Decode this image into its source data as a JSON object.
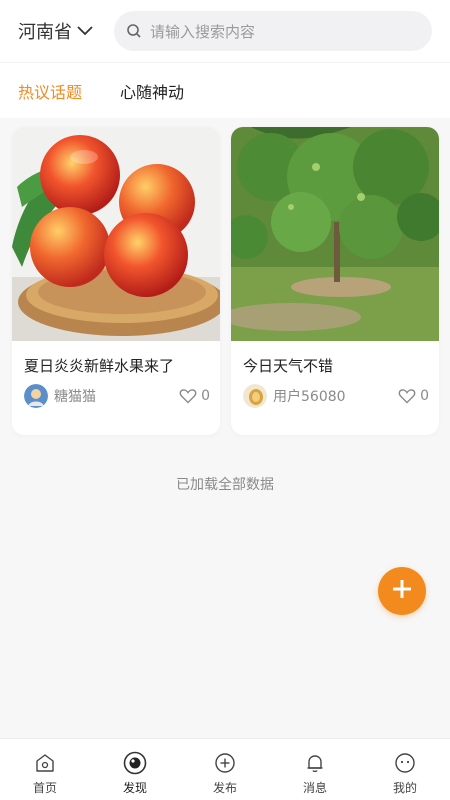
{
  "header": {
    "region": "河南省",
    "search_placeholder": "请输入搜索内容"
  },
  "tabs": [
    {
      "label": "热议话题",
      "active": true
    },
    {
      "label": "心随神动",
      "active": false
    }
  ],
  "posts": [
    {
      "title": "夏日炎炎新鲜水果来了",
      "user": "糖猫猫",
      "likes": "0",
      "image": "peaches-in-basket"
    },
    {
      "title": "今日天气不错",
      "user": "用户56080",
      "likes": "0",
      "image": "fruit-tree"
    }
  ],
  "status": {
    "loaded_all": "已加载全部数据"
  },
  "fab": {
    "icon": "plus-icon"
  },
  "bottom_nav": [
    {
      "label": "首页",
      "icon": "home-icon"
    },
    {
      "label": "发现",
      "icon": "discover-icon",
      "active": true
    },
    {
      "label": "发布",
      "icon": "publish-icon"
    },
    {
      "label": "消息",
      "icon": "bell-icon"
    },
    {
      "label": "我的",
      "icon": "profile-icon"
    }
  ],
  "colors": {
    "accent": "#f28a1d",
    "background": "#f7f7f7"
  }
}
